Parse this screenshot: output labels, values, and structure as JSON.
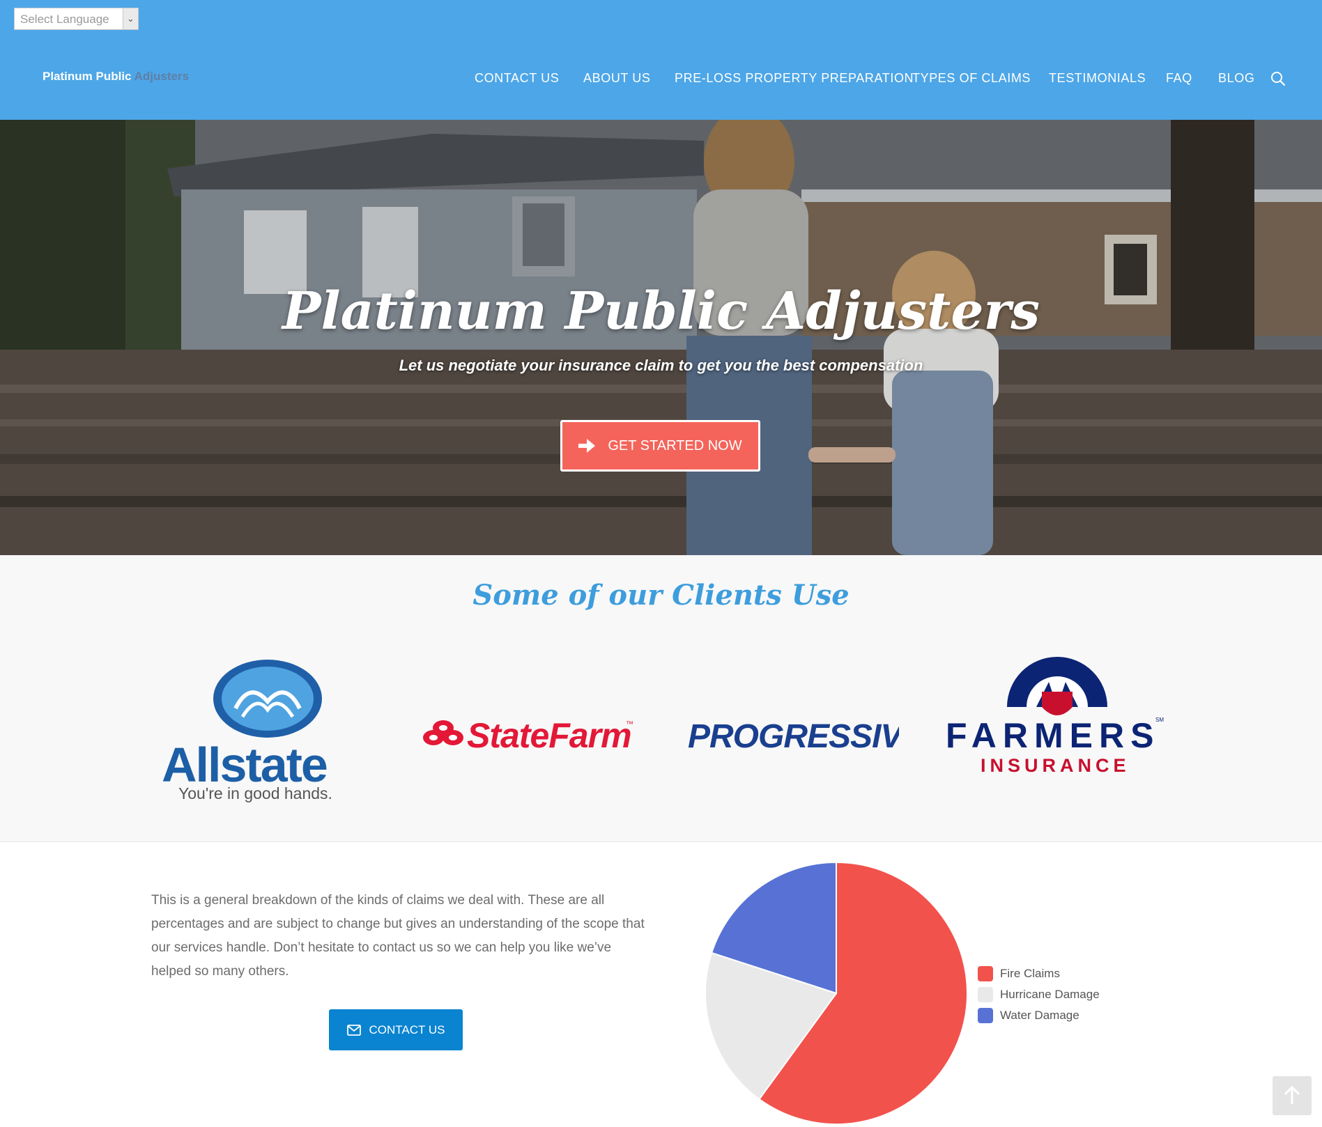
{
  "language_select": {
    "placeholder": "Select Language"
  },
  "brand": {
    "part1": "Platinum Public",
    "part2": "Adjusters"
  },
  "nav": [
    {
      "label": "CONTACT US"
    },
    {
      "label": "ABOUT US"
    },
    {
      "label": "PRE-LOSS PROPERTY PREPARATION"
    },
    {
      "label": "TYPES OF CLAIMS"
    },
    {
      "label": "TESTIMONIALS"
    },
    {
      "label": "FAQ"
    },
    {
      "label": "BLOG"
    }
  ],
  "hero": {
    "title": "Platinum Public Adjusters",
    "subtitle": "Let us negotiate your insurance claim to get you the best compensation",
    "cta_label": "GET STARTED NOW"
  },
  "clients": {
    "title": "Some of our Clients Use",
    "logos": [
      {
        "name": "Allstate",
        "tagline": "You're in good hands."
      },
      {
        "name": "StateFarm",
        "mark": "™"
      },
      {
        "name": "PROGRESSIVE"
      },
      {
        "name": "FARMERS",
        "sub": "INSURANCE",
        "mark": "SM"
      }
    ]
  },
  "breakdown": {
    "text": "This is a general breakdown of the kinds of claims we deal with. These are all percentages and are subject to change but gives an understanding of the scope that our services handle. Don’t hesitate to contact us so we can help you like we’ve helped so many others.",
    "button_label": "CONTACT US"
  },
  "chart_data": {
    "type": "pie",
    "series": [
      {
        "name": "Fire Claims",
        "value": 60,
        "color": "#f2524c"
      },
      {
        "name": "Hurricane Damage",
        "value": 20,
        "color": "#e9e9e9"
      },
      {
        "name": "Water Damage",
        "value": 20,
        "color": "#5772d4"
      }
    ],
    "legend": "right"
  },
  "colors": {
    "header": "#4da6e7",
    "cta": "#f4645a",
    "accent": "#3d9ddd",
    "button": "#0a84d0"
  },
  "icons": {
    "search": "search-icon",
    "cta": "arrow-right-icon",
    "contact": "envelope-icon",
    "scroll_top": "arrow-up-icon"
  }
}
